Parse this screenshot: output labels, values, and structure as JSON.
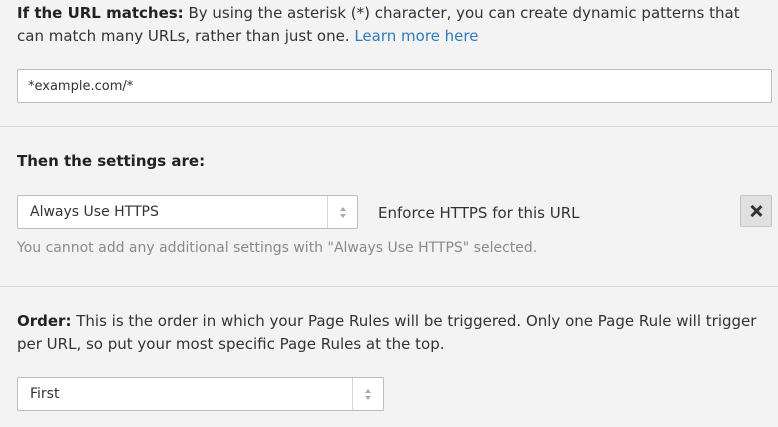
{
  "url_section": {
    "label": "If the URL matches:",
    "description": " By using the asterisk (*) character, you can create dynamic patterns that can match many URLs, rather than just one. ",
    "learn_more_link": "Learn more here",
    "url_value": "*example.com/*"
  },
  "settings_section": {
    "heading": "Then the settings are:",
    "selected_setting": "Always Use HTTPS",
    "setting_description": "Enforce HTTPS for this URL",
    "note": "You cannot add any additional settings with \"Always Use HTTPS\" selected."
  },
  "order_section": {
    "label": "Order:",
    "description": " This is the order in which your Page Rules will be triggered. Only one Page Rule will trigger per URL, so put your most specific Page Rules at the top.",
    "selected_order": "First"
  },
  "colors": {
    "background": "#f3f3f3",
    "link": "#2f7bbf",
    "muted_text": "#8a8a8a",
    "divider": "#d9d9d9"
  },
  "icons": {
    "remove": "close-icon",
    "select_arrows": "updown-arrows-icon"
  }
}
